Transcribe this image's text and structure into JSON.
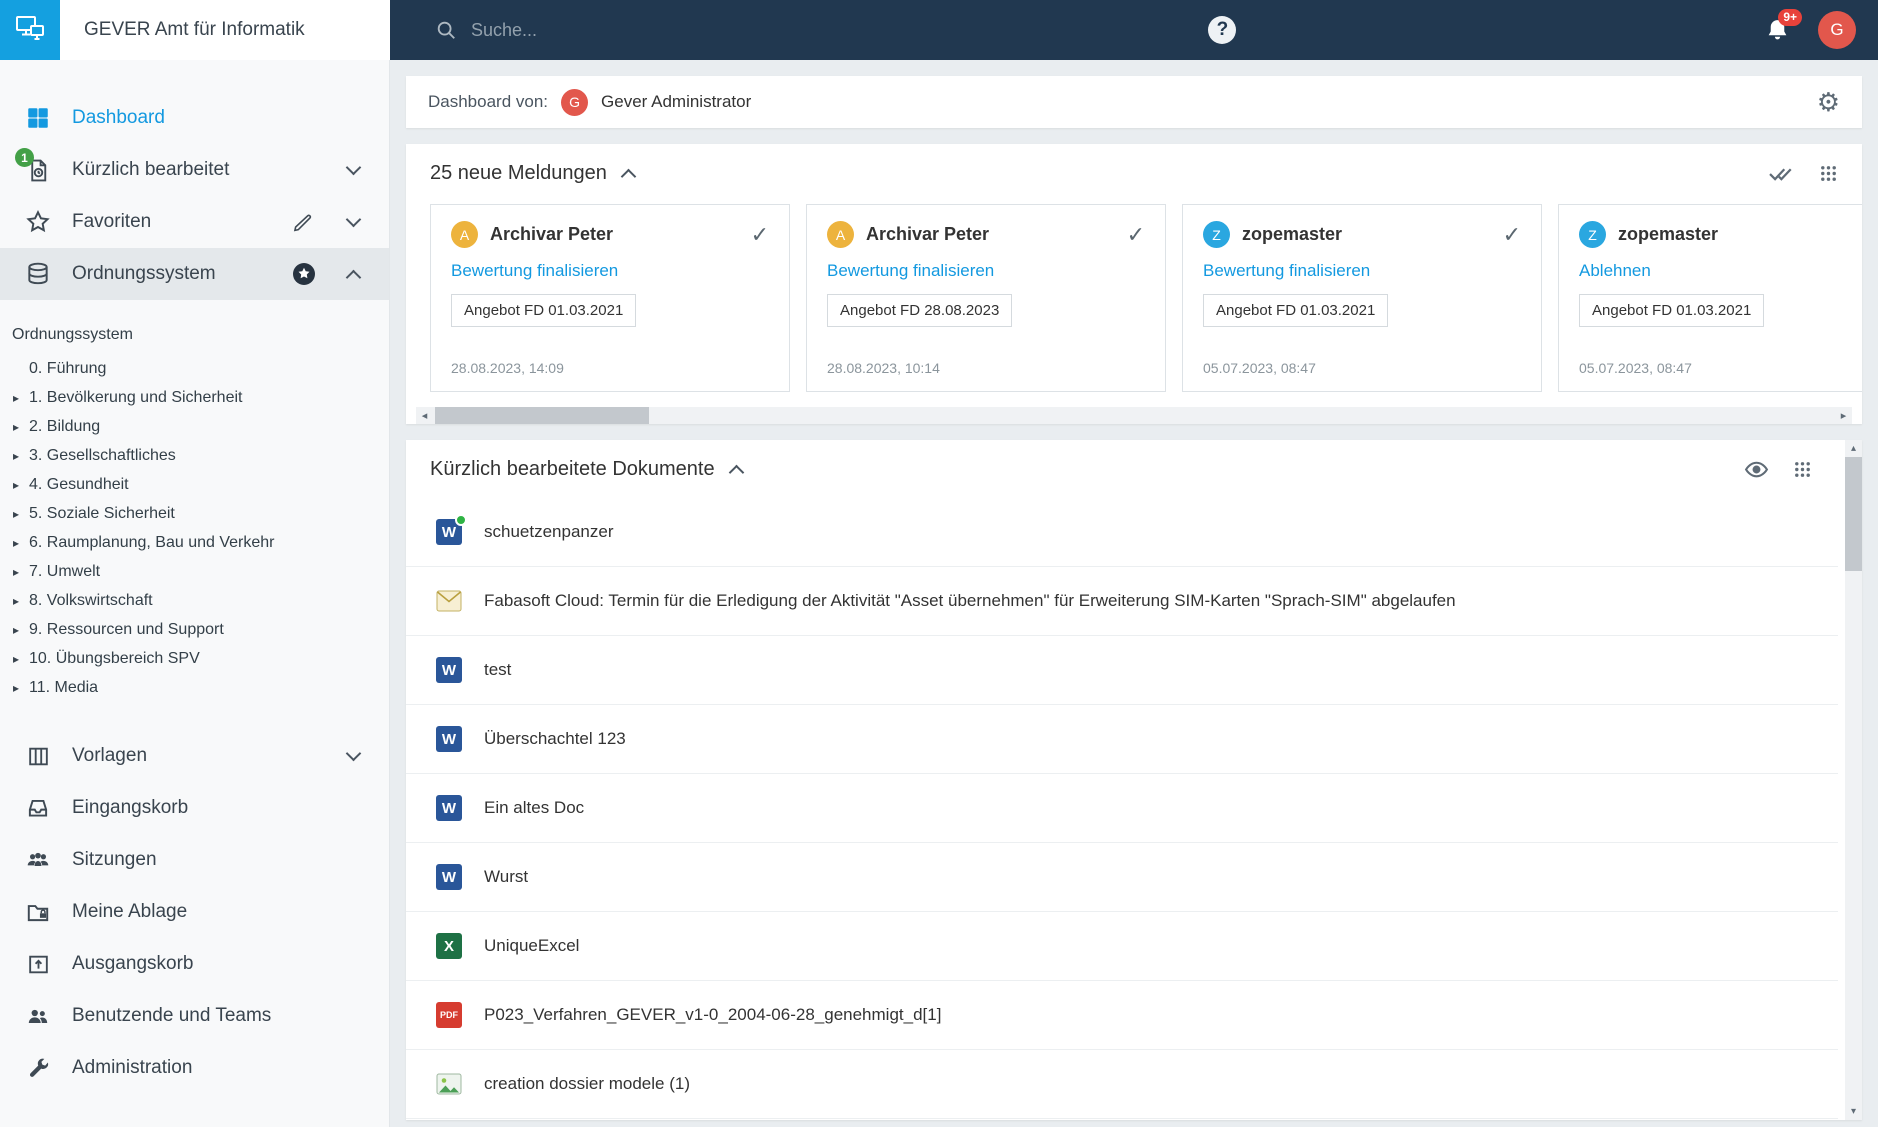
{
  "topbar": {
    "app_title": "GEVER Amt für Informatik",
    "search_placeholder": "Suche...",
    "help_label": "?",
    "notification_count": "9+",
    "user_initial": "G"
  },
  "sidebar": {
    "nav": [
      {
        "label": "Dashboard"
      },
      {
        "label": "Kürzlich bearbeitet",
        "badge": "1"
      },
      {
        "label": "Favoriten"
      },
      {
        "label": "Ordnungssystem"
      }
    ],
    "tree": {
      "header": "Ordnungssystem",
      "items": [
        {
          "arrow": "",
          "label": "0. Führung"
        },
        {
          "arrow": "▸",
          "label": "1. Bevölkerung und Sicherheit"
        },
        {
          "arrow": "▸",
          "label": "2. Bildung"
        },
        {
          "arrow": "▸",
          "label": "3. Gesellschaftliches"
        },
        {
          "arrow": "▸",
          "label": "4. Gesundheit"
        },
        {
          "arrow": "▸",
          "label": "5. Soziale Sicherheit"
        },
        {
          "arrow": "▸",
          "label": "6. Raumplanung, Bau und Verkehr"
        },
        {
          "arrow": "▸",
          "label": "7. Umwelt"
        },
        {
          "arrow": "▸",
          "label": "8. Volkswirtschaft"
        },
        {
          "arrow": "▸",
          "label": "9. Ressourcen und Support"
        },
        {
          "arrow": "▸",
          "label": "10. Übungsbereich SPV"
        },
        {
          "arrow": "▸",
          "label": "11. Media"
        }
      ]
    },
    "nav2": [
      {
        "label": "Vorlagen"
      },
      {
        "label": "Eingangskorb"
      },
      {
        "label": "Sitzungen"
      },
      {
        "label": "Meine Ablage"
      },
      {
        "label": "Ausgangskorb"
      },
      {
        "label": "Benutzende und Teams"
      },
      {
        "label": "Administration"
      }
    ]
  },
  "userbar": {
    "label": "Dashboard von:",
    "user_initial": "G",
    "user_name": "Gever Administrator"
  },
  "notifications": {
    "title": "25 neue Meldungen",
    "cards": [
      {
        "avatar_initial": "A",
        "avatar_color": "#edb33d",
        "name": "Archivar Peter",
        "action": "Bewertung finalisieren",
        "reference": "Angebot FD 01.03.2021",
        "timestamp": "28.08.2023, 14:09",
        "check": "✓"
      },
      {
        "avatar_initial": "A",
        "avatar_color": "#edb33d",
        "name": "Archivar Peter",
        "action": "Bewertung finalisieren",
        "reference": "Angebot FD 28.08.2023",
        "timestamp": "28.08.2023, 10:14",
        "check": "✓"
      },
      {
        "avatar_initial": "Z",
        "avatar_color": "#2aa7e0",
        "name": "zopemaster",
        "action": "Bewertung finalisieren",
        "reference": "Angebot FD 01.03.2021",
        "timestamp": "05.07.2023, 08:47",
        "check": "✓"
      },
      {
        "avatar_initial": "Z",
        "avatar_color": "#2aa7e0",
        "name": "zopemaster",
        "action": "Ablehnen",
        "reference": "Angebot FD 01.03.2021",
        "timestamp": "05.07.2023, 08:47",
        "check": ""
      }
    ]
  },
  "documents": {
    "title": "Kürzlich bearbeitete Dokumente",
    "items": [
      {
        "title": "schuetzenpanzer",
        "icon": "word-document-icon",
        "badge": "W"
      },
      {
        "title": "Fabasoft Cloud: Termin für die Erledigung der Aktivität \"Asset übernehmen\" für Erweiterung SIM-Karten \"Sprach-SIM\" abgelaufen",
        "icon": "email-icon",
        "badge": ""
      },
      {
        "title": "test",
        "icon": "word-document-icon",
        "badge": "W"
      },
      {
        "title": "Überschachtel 123",
        "icon": "word-document-icon",
        "badge": "W"
      },
      {
        "title": "Ein altes Doc",
        "icon": "word-document-icon",
        "badge": "W"
      },
      {
        "title": "Wurst",
        "icon": "word-document-icon",
        "badge": "W"
      },
      {
        "title": "UniqueExcel",
        "icon": "excel-document-icon",
        "badge": "X"
      },
      {
        "title": "P023_Verfahren_GEVER_v1-0_2004-06-28_genehmigt_d[1]",
        "icon": "pdf-document-icon",
        "badge": "PDF"
      },
      {
        "title": "creation dossier modele (1)",
        "icon": "image-document-icon",
        "badge": ""
      }
    ]
  },
  "colors": {
    "accent_blue": "#1399e0",
    "topbar_navy": "#213850",
    "logo_blue": "#14a0e0",
    "badge_red": "#e8423b",
    "badge_green": "#43a047",
    "avatar_red": "#e2574c"
  }
}
